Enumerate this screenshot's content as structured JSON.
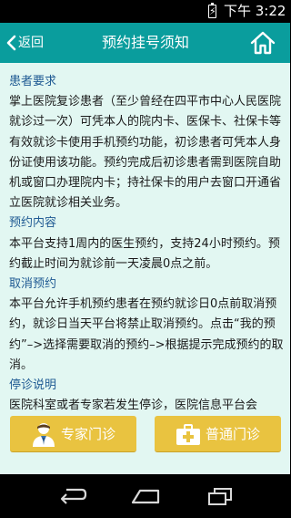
{
  "status_bar": {
    "time": "下午 3:22",
    "battery_bolt": "⚡"
  },
  "header": {
    "back_label": "返回",
    "title": "预约挂号须知"
  },
  "notice": {
    "sections": [
      {
        "heading": "患者要求",
        "body": "掌上医院复诊患者（至少曾经在四平市中心人民医院就诊过一次）可凭本人的院内卡、医保卡、社保卡等有效就诊卡使用手机预约功能，初诊患者可凭本人身份证使用该功能。预约完成后初诊患者需到医院自助机或窗口办理院内卡；持社保卡的用户去窗口开通省立医院就诊相关业务。"
      },
      {
        "heading": "预约内容",
        "body": "本平台支持1周内的医生预约，支持24小时预约。预约截止时间为就诊前一天凌晨0点之前。"
      },
      {
        "heading": "取消预约",
        "body": "本平台允许手机预约患者在预约就诊日0点前取消预约，就诊日当天平台将禁止取消预约。点击“我的预约”–>选择需要取消的预约–>根据提示完成预约的取消。"
      },
      {
        "heading": "停诊说明",
        "body": "医院科室或者专家若发生停诊，医院信息平台会"
      }
    ]
  },
  "actions": {
    "expert_label": "专家门诊",
    "general_label": "普通门诊"
  },
  "colors": {
    "header_bg": "#0a9d9d",
    "content_bg": "#e2f7f2",
    "heading_text": "#1f5a93",
    "button_bg": "#e9c340"
  }
}
